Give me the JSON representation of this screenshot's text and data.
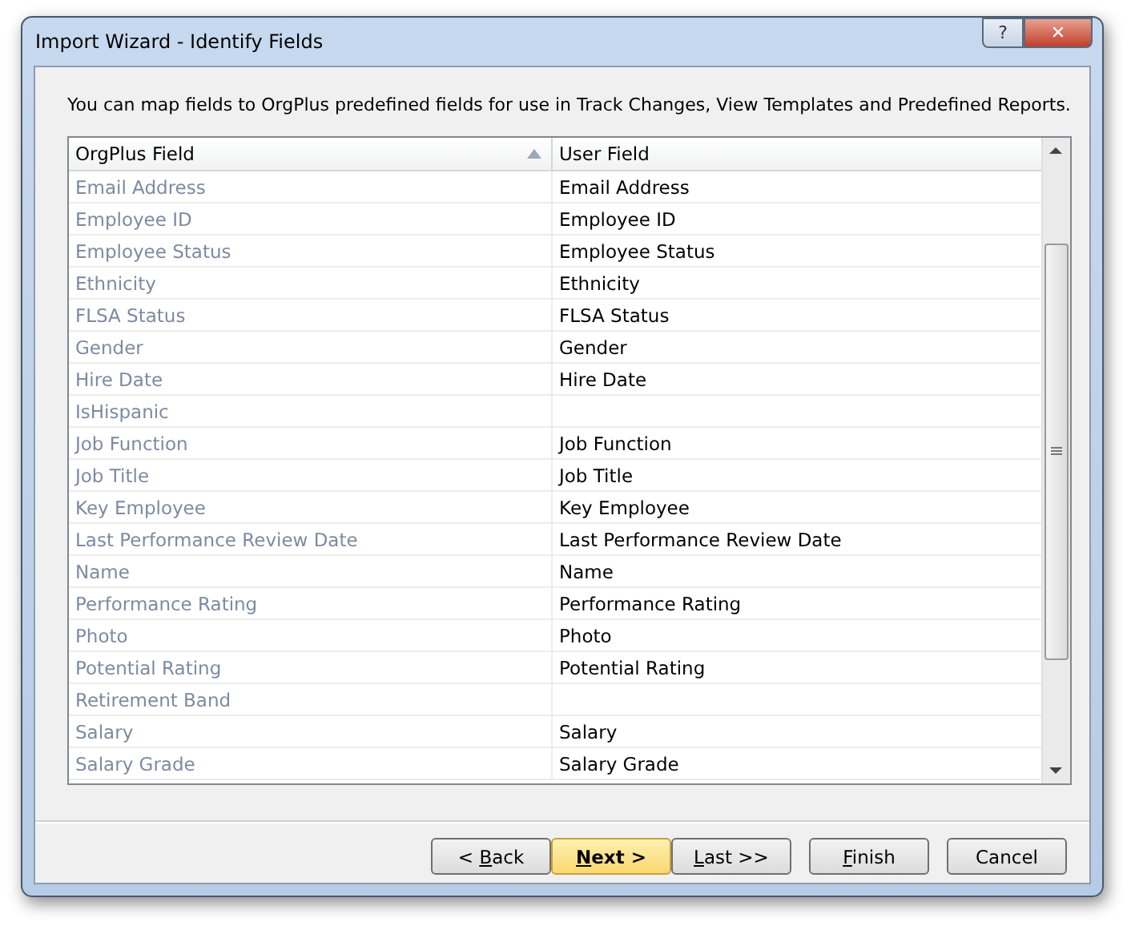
{
  "window": {
    "title": "Import Wizard - Identify Fields",
    "controls": [
      "?",
      "✕"
    ]
  },
  "description": "You can map fields to OrgPlus predefined fields for use in Track Changes, View Templates and Predefined Reports.",
  "table": {
    "columns": [
      {
        "label": "OrgPlus Field",
        "sorted": true
      },
      {
        "label": "User Field",
        "sorted": false
      }
    ],
    "rows": [
      {
        "orgplus": "Email Address",
        "user": "Email Address"
      },
      {
        "orgplus": "Employee ID",
        "user": "Employee ID"
      },
      {
        "orgplus": "Employee Status",
        "user": "Employee Status"
      },
      {
        "orgplus": "Ethnicity",
        "user": "Ethnicity"
      },
      {
        "orgplus": "FLSA Status",
        "user": "FLSA Status"
      },
      {
        "orgplus": "Gender",
        "user": "Gender"
      },
      {
        "orgplus": "Hire Date",
        "user": "Hire Date"
      },
      {
        "orgplus": "IsHispanic"
      },
      {
        "orgplus": "Job Function",
        "user": "Job Function"
      },
      {
        "orgplus": "Job Title",
        "user": "Job Title"
      },
      {
        "orgplus": "Key Employee",
        "user": "Key Employee"
      },
      {
        "orgplus": "Last Performance Review Date",
        "user": "Last Performance Review Date"
      },
      {
        "orgplus": "Name",
        "user": "Name"
      },
      {
        "orgplus": "Performance Rating",
        "user": "Performance Rating"
      },
      {
        "orgplus": "Photo",
        "user": "Photo"
      },
      {
        "orgplus": "Potential Rating",
        "user": "Potential Rating"
      },
      {
        "orgplus": "Retirement Band"
      },
      {
        "orgplus": "Salary",
        "user": "Salary"
      },
      {
        "orgplus": "Salary Grade",
        "user": "Salary Grade"
      }
    ]
  },
  "buttons": [
    {
      "before": "< ",
      "key": "B",
      "after": "ack",
      "default": false
    },
    {
      "key": "N",
      "after": "ext >",
      "default": true
    },
    {
      "key": "L",
      "after": "ast >>",
      "default": false
    },
    {
      "key": "F",
      "after": "inish",
      "default": false
    },
    {
      "before": "Cancel",
      "default": false
    }
  ]
}
